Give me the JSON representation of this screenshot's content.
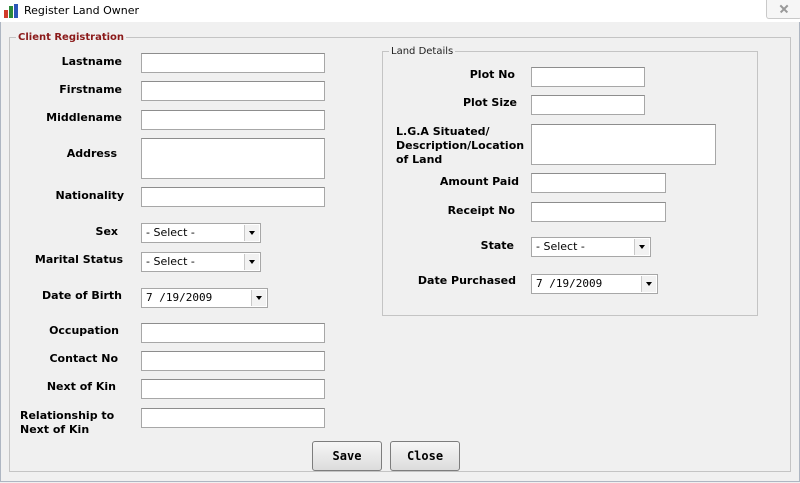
{
  "window": {
    "title": "Register Land Owner"
  },
  "client": {
    "legend": "Client Registration",
    "lastname": "Lastname",
    "firstname": "Firstname",
    "middlename": "Middlename",
    "address": "Address",
    "nationality": "Nationality",
    "sex": "Sex",
    "sex_value": "- Select -",
    "marital": "Marital Status",
    "marital_value": "- Select -",
    "dob": "Date of Birth",
    "dob_value": "7 /19/2009",
    "occupation": "Occupation",
    "contact": "Contact No",
    "kin": "Next of Kin",
    "relationship": "Relationship to Next of Kin"
  },
  "land": {
    "legend": "Land Details",
    "plot_no": "Plot No",
    "plot_size": "Plot Size",
    "lga": "L.G.A Situated/ Description/Location of Land",
    "amount": "Amount Paid",
    "receipt": "Receipt No",
    "state": "State",
    "state_value": "- Select -",
    "date_purchased": "Date Purchased",
    "date_purchased_value": "7 /19/2009"
  },
  "buttons": {
    "save": "Save",
    "close": "Close"
  }
}
